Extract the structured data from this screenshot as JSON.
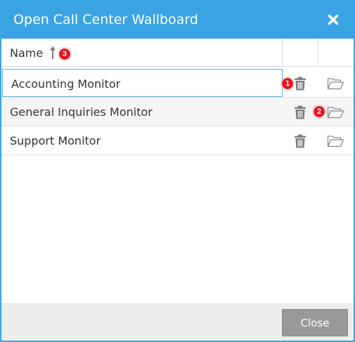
{
  "dialog": {
    "title": "Open Call Center Wallboard",
    "accent_color": "#3aa3e3"
  },
  "table": {
    "header": {
      "name_label": "Name",
      "sort": "ascending"
    },
    "rows": [
      {
        "name": "Accounting Monitor",
        "selected": true
      },
      {
        "name": "General Inquiries Monitor",
        "selected": false
      },
      {
        "name": "Support Monitor",
        "selected": false
      }
    ]
  },
  "badges": {
    "first": "1",
    "second": "2",
    "third": "3"
  },
  "footer": {
    "close_label": "Close"
  },
  "icons": {
    "close": "close-icon",
    "sort": "sort-ascending-icon",
    "delete": "trash-icon",
    "open": "folder-open-icon"
  }
}
